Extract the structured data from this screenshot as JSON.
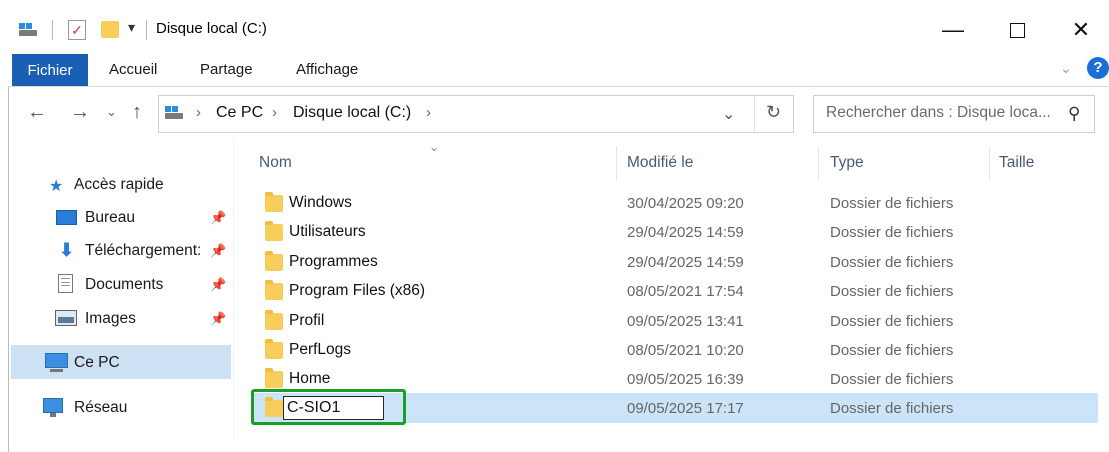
{
  "window": {
    "title": "Disque local (C:)"
  },
  "ribbon": {
    "tabs": [
      "Fichier",
      "Accueil",
      "Partage",
      "Affichage"
    ]
  },
  "address": {
    "crumbs": [
      "Ce PC",
      "Disque local (C:)"
    ],
    "search_placeholder": "Rechercher dans : Disque loca..."
  },
  "nav": {
    "quick_access": "Accès rapide",
    "items": [
      "Bureau",
      "Téléchargement:",
      "Documents",
      "Images"
    ],
    "this_pc": "Ce PC",
    "network": "Réseau"
  },
  "columns": {
    "name": "Nom",
    "modified": "Modifié le",
    "type": "Type",
    "size": "Taille"
  },
  "files": [
    {
      "name": "Windows",
      "modified": "30/04/2025 09:20",
      "type": "Dossier de fichiers"
    },
    {
      "name": "Utilisateurs",
      "modified": "29/04/2025 14:59",
      "type": "Dossier de fichiers"
    },
    {
      "name": "Programmes",
      "modified": "29/04/2025 14:59",
      "type": "Dossier de fichiers"
    },
    {
      "name": "Program Files (x86)",
      "modified": "08/05/2021 17:54",
      "type": "Dossier de fichiers"
    },
    {
      "name": "Profil",
      "modified": "09/05/2025 13:41",
      "type": "Dossier de fichiers"
    },
    {
      "name": "PerfLogs",
      "modified": "08/05/2021 10:20",
      "type": "Dossier de fichiers"
    },
    {
      "name": "Home",
      "modified": "09/05/2025 16:39",
      "type": "Dossier de fichiers"
    }
  ],
  "renaming": {
    "name": "C-SIO1",
    "modified": "09/05/2025 17:17",
    "type": "Dossier de fichiers"
  },
  "colors": {
    "accent": "#1a5fb4",
    "selection": "#cce4f7",
    "highlight": "#1a9e2a"
  }
}
